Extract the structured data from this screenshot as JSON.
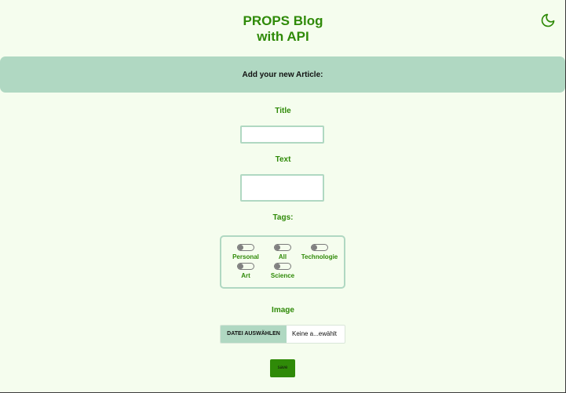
{
  "header": {
    "title_line1": "PROPS Blog",
    "title_line2": "with API",
    "theme_toggle_icon": "moon-icon"
  },
  "banner": {
    "text": "Add your new Article:"
  },
  "form": {
    "title_label": "Title",
    "title_value": "",
    "text_label": "Text",
    "text_value": "",
    "tags_label": "Tags:",
    "tags": [
      {
        "label": "Personal",
        "checked": false
      },
      {
        "label": "All",
        "checked": false
      },
      {
        "label": "Technologie",
        "checked": false
      },
      {
        "label": "Art",
        "checked": false
      },
      {
        "label": "Science",
        "checked": false
      }
    ],
    "image_label": "Image",
    "file_button": "DATEI AUSWÄHLEN",
    "file_status": "Keine a...ewählt",
    "save_label": "save"
  },
  "colors": {
    "background": "#f5fdee",
    "accent_green": "#2f8a08",
    "banner_mint": "#b0d8c2"
  }
}
